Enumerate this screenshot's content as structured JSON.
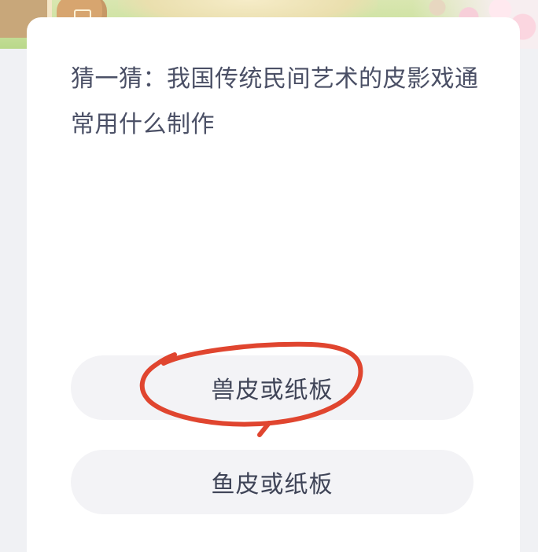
{
  "banner": {
    "icon": "garden-illustration"
  },
  "quiz": {
    "question": "猜一猜：我国传统民间艺术的皮影戏通常用什么制作",
    "options": [
      {
        "label": "兽皮或纸板"
      },
      {
        "label": "鱼皮或纸板"
      }
    ]
  },
  "annotation": {
    "circled_option_index": 0,
    "color": "#e0452f"
  }
}
